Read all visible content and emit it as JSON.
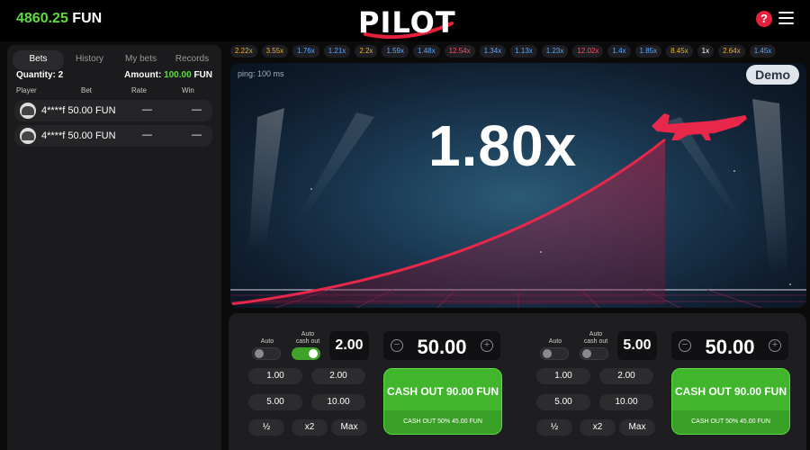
{
  "header": {
    "balance_value": "4860.25",
    "balance_currency": "FUN",
    "logo_text": "PILOT"
  },
  "sidebar": {
    "tabs": [
      "Bets",
      "History",
      "My bets",
      "Records"
    ],
    "quantity_label": "Quantity:",
    "quantity_value": "2",
    "amount_label": "Amount:",
    "amount_value": "100.00",
    "amount_currency": "FUN",
    "columns": [
      "Player",
      "Bet",
      "Rate",
      "Win"
    ],
    "rows": [
      {
        "player": "4****f",
        "bet": "50.00 FUN",
        "rate": "—",
        "win": "—"
      },
      {
        "player": "4****f",
        "bet": "50.00 FUN",
        "rate": "—",
        "win": "—"
      }
    ]
  },
  "history": [
    {
      "value": "2.22x",
      "color": "#e8b12c"
    },
    {
      "value": "3.55x",
      "color": "#e8b12c"
    },
    {
      "value": "1.76x",
      "color": "#5aa8ff"
    },
    {
      "value": "1.21x",
      "color": "#5aa8ff"
    },
    {
      "value": "2.2x",
      "color": "#e8b12c"
    },
    {
      "value": "1.59x",
      "color": "#5aa8ff"
    },
    {
      "value": "1.48x",
      "color": "#5aa8ff"
    },
    {
      "value": "12.54x",
      "color": "#ff4d6a"
    },
    {
      "value": "1.34x",
      "color": "#5aa8ff"
    },
    {
      "value": "1.13x",
      "color": "#5aa8ff"
    },
    {
      "value": "1.23x",
      "color": "#5aa8ff"
    },
    {
      "value": "12.02x",
      "color": "#ff4d6a"
    },
    {
      "value": "1.4x",
      "color": "#5aa8ff"
    },
    {
      "value": "1.85x",
      "color": "#5aa8ff"
    },
    {
      "value": "8.45x",
      "color": "#e8b12c"
    },
    {
      "value": "1x",
      "color": "#ffffff"
    },
    {
      "value": "2.64x",
      "color": "#e8b12c"
    },
    {
      "value": "1.45x",
      "color": "#5aa8ff"
    }
  ],
  "game": {
    "ping": "ping: 100 ms",
    "mode_badge": "Demo",
    "multiplier": "1.80x"
  },
  "bet_panels": [
    {
      "auto_label": "Auto",
      "auto_cashout_label": "Auto\ncash out",
      "auto_on": false,
      "auto_cashout_on": true,
      "coefficient": "2.00",
      "stake": "50.00",
      "presets": [
        "1.00",
        "2.00",
        "5.00",
        "10.00"
      ],
      "modifiers": [
        "½",
        "x2",
        "Max"
      ],
      "cashout_label": "CASH OUT 90.00 FUN",
      "cashout_partial": "CASH OUT 50% 45.00 FUN"
    },
    {
      "auto_label": "Auto",
      "auto_cashout_label": "Auto\ncash out",
      "auto_on": false,
      "auto_cashout_on": false,
      "coefficient": "5.00",
      "stake": "50.00",
      "presets": [
        "1.00",
        "2.00",
        "5.00",
        "10.00"
      ],
      "modifiers": [
        "½",
        "x2",
        "Max"
      ],
      "cashout_label": "CASH OUT 90.00 FUN",
      "cashout_partial": "CASH OUT 50%  45.00 FUN"
    }
  ],
  "colors": {
    "accent_green": "#5ddc3d",
    "brand_red": "#e4203b",
    "plane_red": "#e8284a"
  }
}
